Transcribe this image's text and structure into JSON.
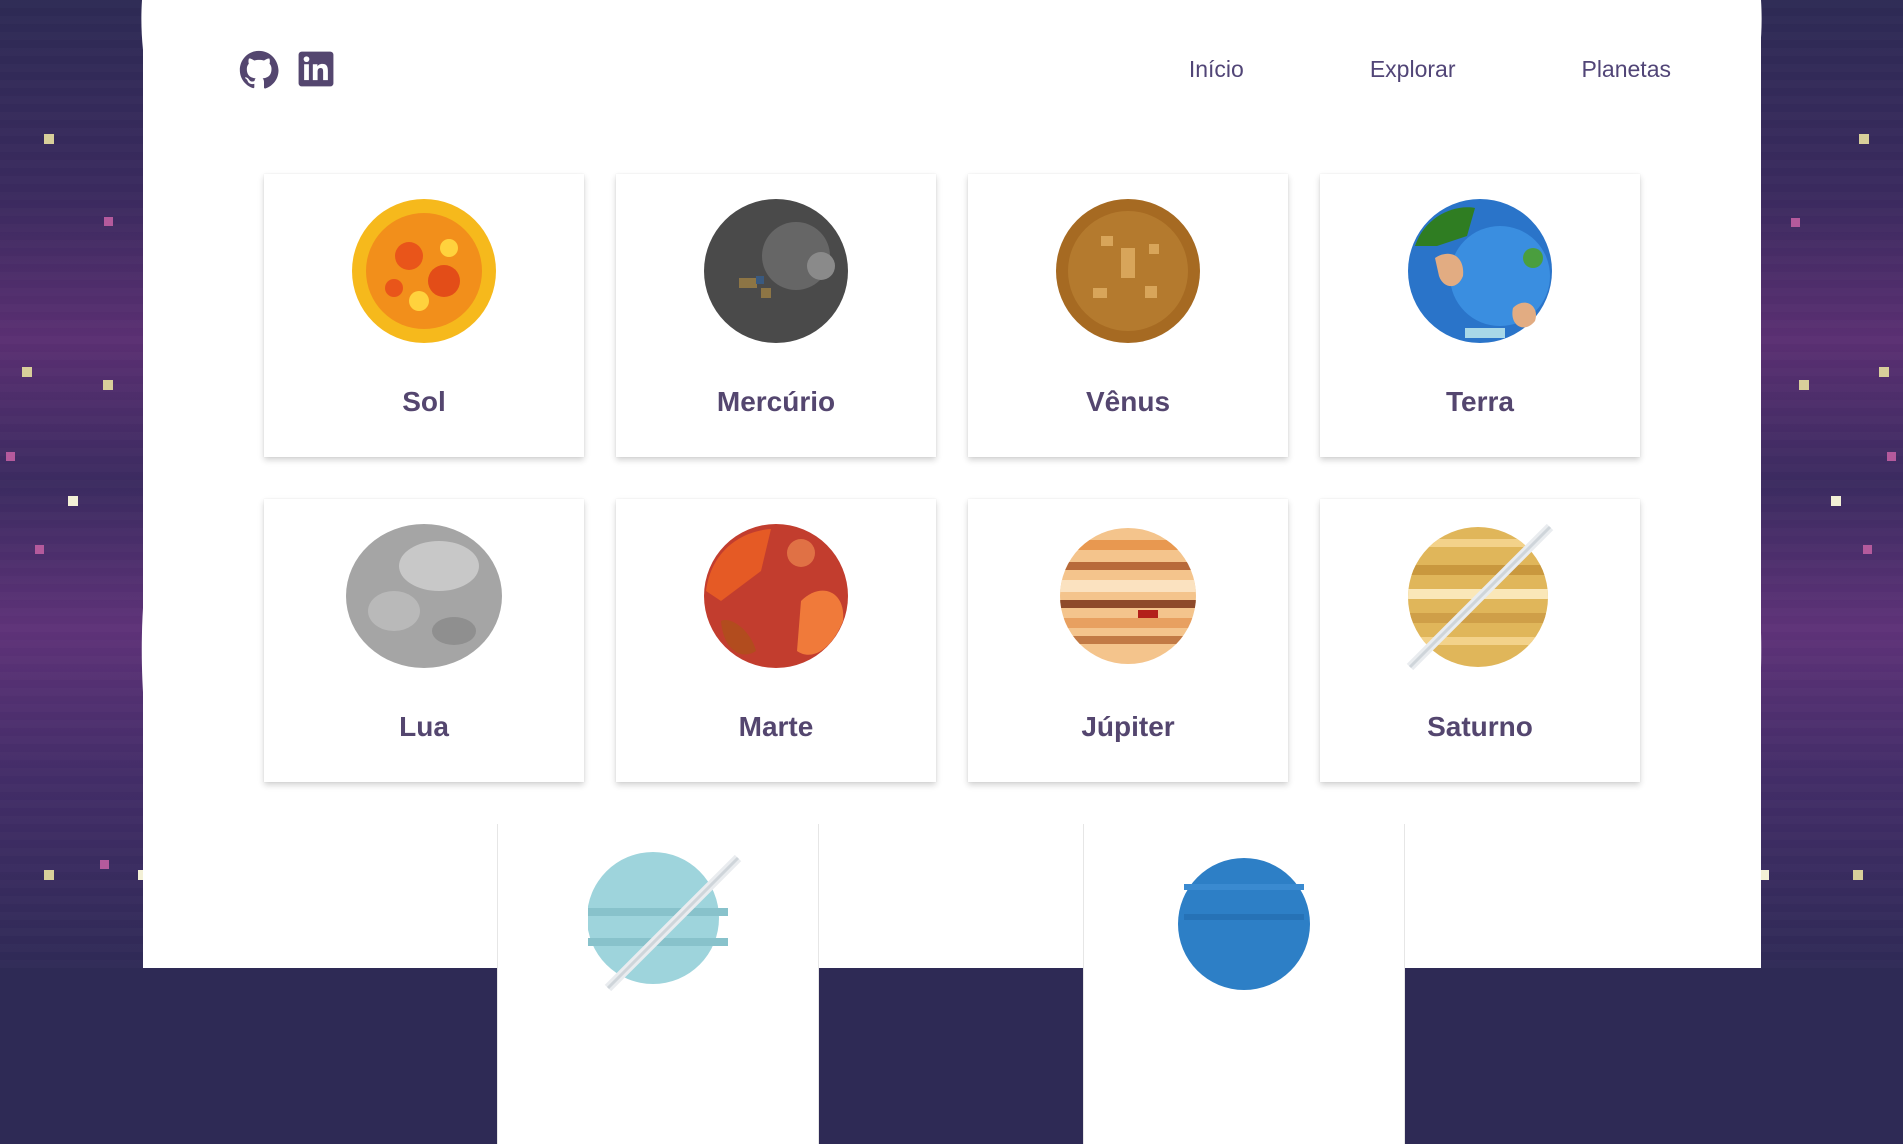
{
  "nav": {
    "items": [
      "Início",
      "Explorar",
      "Planetas"
    ]
  },
  "social": {
    "github_icon": "github-icon",
    "linkedin_icon": "linkedin-icon"
  },
  "colors": {
    "accent": "#54466f",
    "nav_text": "#514577",
    "space_dark": "#2e2a55",
    "space_purple": "#5e3278"
  },
  "planets": [
    {
      "name": "Sol",
      "icon": "sun-icon"
    },
    {
      "name": "Mercúrio",
      "icon": "mercury-icon"
    },
    {
      "name": "Vênus",
      "icon": "venus-icon"
    },
    {
      "name": "Terra",
      "icon": "earth-icon"
    },
    {
      "name": "Lua",
      "icon": "moon-icon"
    },
    {
      "name": "Marte",
      "icon": "mars-icon"
    },
    {
      "name": "Júpiter",
      "icon": "jupiter-icon"
    },
    {
      "name": "Saturno",
      "icon": "saturn-icon"
    },
    {
      "name": "",
      "icon": "uranus-icon"
    },
    {
      "name": "",
      "icon": "neptune-icon"
    }
  ]
}
